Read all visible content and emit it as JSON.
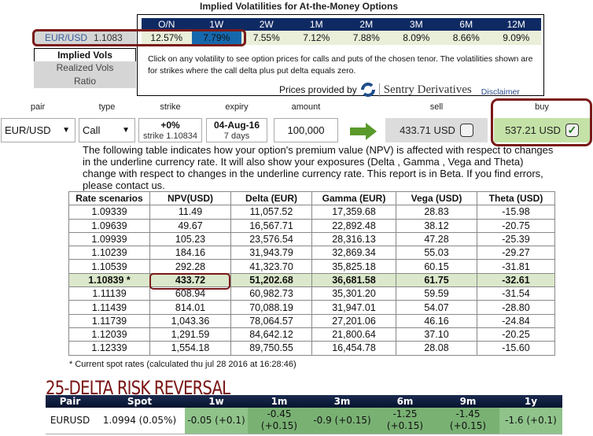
{
  "iv": {
    "title": "Implied Volatilities for At-the-Money Options",
    "pair": "EUR/USD",
    "spot": "1.1083",
    "tenors": [
      "O/N",
      "1W",
      "2W",
      "1M",
      "2M",
      "3M",
      "6M",
      "12M"
    ],
    "values": [
      "12.57%",
      "7.79%",
      "7.55%",
      "7.12%",
      "7.88%",
      "8.09%",
      "8.66%",
      "9.09%"
    ],
    "selected_index": 1,
    "tabs": [
      "Implied Vols",
      "Realized Vols",
      "Ratio"
    ],
    "description": "Click on any volatility to see option prices for calls and puts of the chosen tenor. The volatilities shown are for strikes where the call delta plus put delta equals zero.",
    "prices_by": "Prices provided by",
    "provider": "Sentry Derivatives",
    "disclaimer": "Disclaimer"
  },
  "form": {
    "labels": {
      "pair": "pair",
      "type": "type",
      "strike": "strike",
      "expiry": "expiry",
      "amount": "amount",
      "sell": "sell",
      "buy": "buy"
    },
    "pair": "EUR/USD",
    "type": "Call",
    "strike_pct": "+0%",
    "strike": "strike 1.10834",
    "expiry": "04-Aug-16",
    "days": "7 days",
    "amount": "100,000",
    "sell": "433.71 USD",
    "buy": "537.21 USD",
    "buy_checked": true,
    "sell_checked": false
  },
  "description": "The following table indicates how your option's premium value (NPV) is affected with respect to changes in the underline currency rate. It will also show your exposures (Delta , Gamma , Vega and Theta) change with respect to changes in the underline currency rate. This report is in Beta. If you find errors, please contact us.",
  "table": {
    "headers": [
      "Rate scenarios",
      "NPV(USD)",
      "Delta (EUR)",
      "Gamma (EUR)",
      "Vega (USD)",
      "Theta (USD)"
    ],
    "rows": [
      [
        "1.09339",
        "11.49",
        "11,057.52",
        "17,359.68",
        "28.83",
        "-15.98"
      ],
      [
        "1.09639",
        "49.67",
        "16,567.71",
        "22,892.48",
        "38.12",
        "-20.75"
      ],
      [
        "1.09939",
        "105.23",
        "23,576.54",
        "28,316.13",
        "47.28",
        "-25.39"
      ],
      [
        "1.10239",
        "184.16",
        "31,943.79",
        "32,869.34",
        "55.03",
        "-29.27"
      ],
      [
        "1.10539",
        "292.28",
        "41,323.70",
        "35,825.18",
        "60.15",
        "-31.81"
      ],
      [
        "1.10839 *",
        "433.72",
        "51,202.68",
        "36,681.58",
        "61.75",
        "-32.61"
      ],
      [
        "1.11139",
        "608.94",
        "60,982.73",
        "35,301.20",
        "59.59",
        "-31.54"
      ],
      [
        "1.11439",
        "814.01",
        "70,088.19",
        "31,947.01",
        "54.07",
        "-28.80"
      ],
      [
        "1.11739",
        "1,043.36",
        "78,064.57",
        "27,201.06",
        "46.16",
        "-24.84"
      ],
      [
        "1.12039",
        "1,291.59",
        "84,642.12",
        "21,800.64",
        "37.10",
        "-20.25"
      ],
      [
        "1.12339",
        "1,554.18",
        "89,750.55",
        "16,454.78",
        "28.08",
        "-15.60"
      ]
    ],
    "current_index": 5,
    "footnote": "* Current spot rates (calculated thu jul 28 2016 at 16:28:46)"
  },
  "rr": {
    "title": "25-DELTA RISK REVERSAL",
    "headers": [
      "Pair",
      "Spot",
      "1w",
      "1m",
      "3m",
      "6m",
      "9m",
      "1y"
    ],
    "row": [
      "EURUSD",
      "1.0994 (0.05%)",
      "-0.05 (+0.1)",
      "-0.45 (+0.15)",
      "-0.9 (+0.15)",
      "-1.25 (+0.15)",
      "-1.45 (+0.15)",
      "-1.6 (+0.1)"
    ]
  }
}
